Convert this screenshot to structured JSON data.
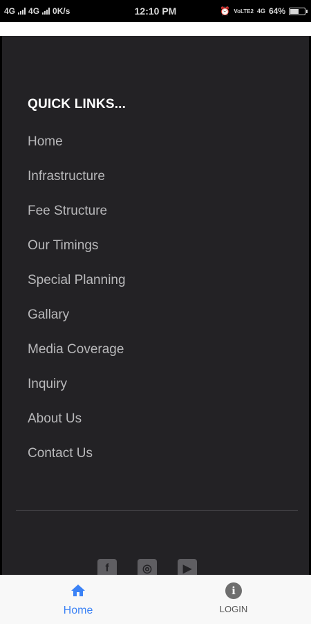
{
  "status_bar": {
    "network1": "4G",
    "network2": "4G",
    "speed": "0K/s",
    "time": "12:10 PM",
    "volte": "VoLTE2",
    "network3": "4G",
    "battery": "64%",
    "battery_level": 0.64
  },
  "quick_links": {
    "title": "QUICK LINKS...",
    "items": [
      {
        "label": "Home"
      },
      {
        "label": "Infrastructure"
      },
      {
        "label": "Fee Structure"
      },
      {
        "label": "Our Timings"
      },
      {
        "label": "Special Planning"
      },
      {
        "label": "Gallary"
      },
      {
        "label": "Media Coverage"
      },
      {
        "label": "Inquiry"
      },
      {
        "label": "About Us"
      },
      {
        "label": "Contact Us"
      }
    ]
  },
  "social": [
    {
      "icon": "facebook-icon",
      "glyph": "f"
    },
    {
      "icon": "instagram-icon",
      "glyph": "◎"
    },
    {
      "icon": "youtube-icon",
      "glyph": "▶"
    }
  ],
  "bottom_nav": {
    "home_label": "Home",
    "login_label": "LOGIN"
  },
  "colors": {
    "panel": "#232225",
    "active": "#3b82f6"
  }
}
